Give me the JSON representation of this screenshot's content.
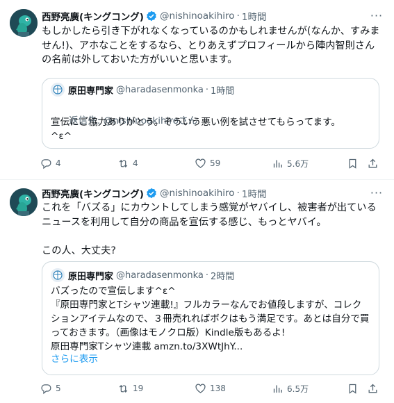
{
  "tweets": [
    {
      "author": {
        "name": "西野亮廣(キングコング)",
        "handle": "@nishinoakihiro",
        "time": "1時間"
      },
      "text": "もしかしたら引き下がれなくなっているのかもしれませんが(なんか、すみません!)、アホなことをするなら、とりあえずプロフィールから陣内智則さんの名前は外しておいた方がいいと思います。",
      "quote": {
        "name": "原田専門家",
        "handle": "@haradasenmonka",
        "time": "1時間",
        "reply_label": "返信先: ",
        "reply_handle": "@nishinoakihiro",
        "reply_suffix": "さん",
        "text": "宣伝にご協力ありがとう。そういう悪い例を試させてもらってます。\n^ε^"
      },
      "stats": {
        "replies": "4",
        "reposts": "4",
        "likes": "59",
        "views": "5.6万"
      }
    },
    {
      "author": {
        "name": "西野亮廣(キングコング)",
        "handle": "@nishinoakihiro",
        "time": "1時間"
      },
      "text": "これを「バズる」にカウントしてしまう感覚がヤバイし、被害者が出ているニュースを利用して自分の商品を宣伝する感じ、もっとヤバイ。\n\nこの人、大丈夫?",
      "quote": {
        "name": "原田専門家",
        "handle": "@haradasenmonka",
        "time": "2時間",
        "text": "バズったので宣伝します^ε^\n『原田専門家とTシャツ連載!』フルカラーなんでお値段しますが、コレクションアイテムなので、３冊売れればボクはもう満足です。あとは自分で買っておきます。（画像はモノクロ版）Kindle版もあるよ!\n原田専門家Tシャツ連載 amzn.to/3XWtJhY...",
        "show_more": "さらに表示"
      },
      "stats": {
        "replies": "5",
        "reposts": "19",
        "likes": "138",
        "views": "6.5万"
      }
    }
  ]
}
